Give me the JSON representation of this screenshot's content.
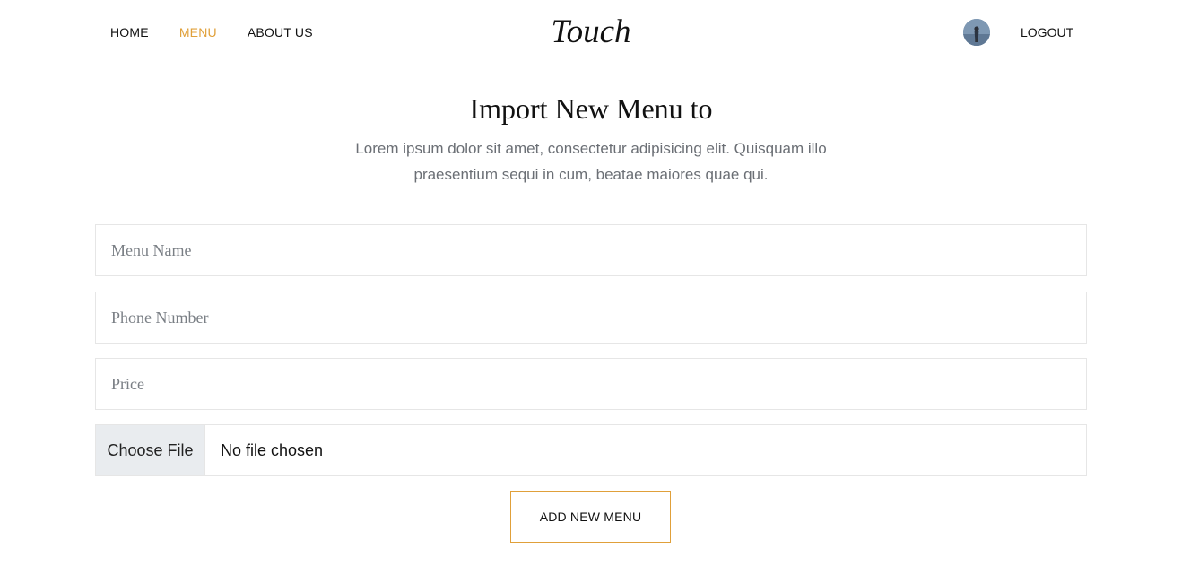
{
  "nav": {
    "items": [
      {
        "label": "HOME",
        "active": false
      },
      {
        "label": "MENU",
        "active": true
      },
      {
        "label": "ABOUT US",
        "active": false
      }
    ],
    "logo": "Touch",
    "logout_label": "LOGOUT",
    "active_color": "#e0a03a"
  },
  "main": {
    "title": "Import New Menu to",
    "subtitle": "Lorem ipsum dolor sit amet, consectetur adipisicing elit. Quisquam illo praesentium sequi in cum, beatae maiores quae qui."
  },
  "form": {
    "menu_name_placeholder": "Menu Name",
    "phone_placeholder": "Phone Number",
    "price_placeholder": "Price",
    "file_button_label": "Choose File",
    "file_status": "No file chosen",
    "submit_label": "ADD NEW MENU",
    "submit_border_color": "#e0a03a"
  },
  "icons": {
    "avatar": "user-avatar-photo"
  }
}
